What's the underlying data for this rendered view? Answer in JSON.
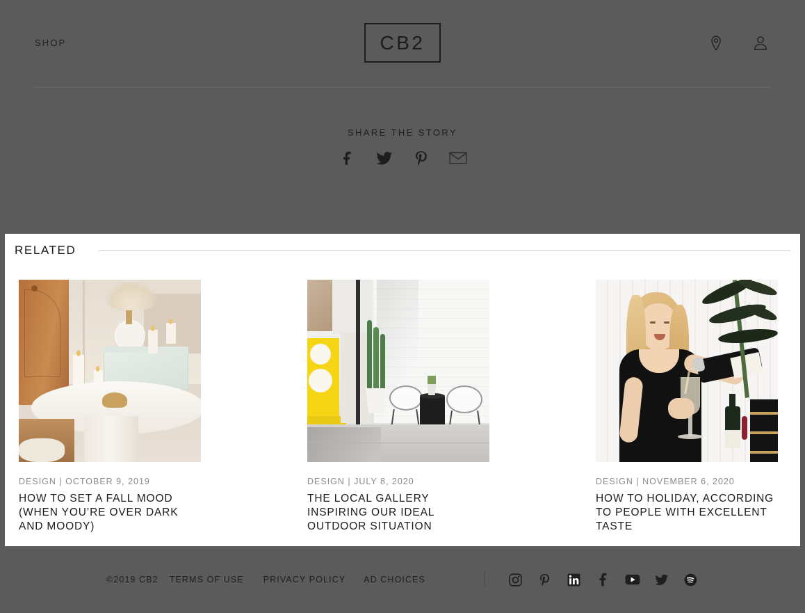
{
  "header": {
    "shop_label": "SHOP",
    "logo_text": "CB2",
    "icons": [
      {
        "name": "store-locator-icon",
        "label": "Store Locator"
      },
      {
        "name": "account-icon",
        "label": "Account"
      }
    ]
  },
  "share": {
    "title": "SHARE THE STORY",
    "icons": [
      {
        "name": "facebook-icon",
        "label": "Facebook"
      },
      {
        "name": "twitter-icon",
        "label": "Twitter"
      },
      {
        "name": "pinterest-icon",
        "label": "Pinterest"
      },
      {
        "name": "email-icon",
        "label": "Email"
      }
    ]
  },
  "related": {
    "title": "RELATED",
    "cards": [
      {
        "category": "DESIGN",
        "separator": "|",
        "date": "OCTOBER 9, 2019",
        "meta": "DESIGN | OCTOBER 9, 2019",
        "heading": "HOW TO SET A FALL MOOD (WHEN YOU’RE OVER DARK AND MOODY)",
        "image_alt": "Warm interior with lit candles, mirrored tray and glass vase of pampas grass on a white round table"
      },
      {
        "category": "DESIGN",
        "separator": "|",
        "date": "JULY 8, 2020",
        "meta": "DESIGN | JULY 8, 2020",
        "heading": "THE LOCAL GALLERY INSPIRING OUR IDEAL OUTDOOR SITUATION",
        "image_alt": "Outdoor patio with white brick wall, yellow sculpture, tall cactus in white planter and two white wire lounge chairs"
      },
      {
        "category": "DESIGN",
        "separator": "|",
        "date": "NOVEMBER 6, 2020",
        "meta": "DESIGN | NOVEMBER 6, 2020",
        "heading": "HOW TO HOLIDAY, ACCORDING TO PEOPLE WITH EXCELLENT TASTE",
        "image_alt": "Blonde woman in black dress pouring champagne into a flute beside a dark palm plant"
      }
    ]
  },
  "footer": {
    "copyright": "©2019 CB2",
    "links": [
      {
        "name": "terms-of-use-link",
        "label": "TERMS OF USE"
      },
      {
        "name": "privacy-policy-link",
        "label": "PRIVACY POLICY"
      },
      {
        "name": "ad-choices-link",
        "label": "AD CHOICES"
      }
    ],
    "social": [
      {
        "name": "instagram-icon",
        "label": "Instagram"
      },
      {
        "name": "pinterest-icon",
        "label": "Pinterest"
      },
      {
        "name": "linkedin-icon",
        "label": "LinkedIn"
      },
      {
        "name": "facebook-icon",
        "label": "Facebook"
      },
      {
        "name": "youtube-icon",
        "label": "YouTube"
      },
      {
        "name": "twitter-icon",
        "label": "Twitter"
      },
      {
        "name": "spotify-icon",
        "label": "Spotify"
      }
    ]
  },
  "colors": {
    "page_background": "#5b5b5b",
    "panel_background": "#ffffff",
    "text_dark": "#1b1b1b",
    "text_muted": "#8a8a8a",
    "rule": "#c9c9c9"
  }
}
